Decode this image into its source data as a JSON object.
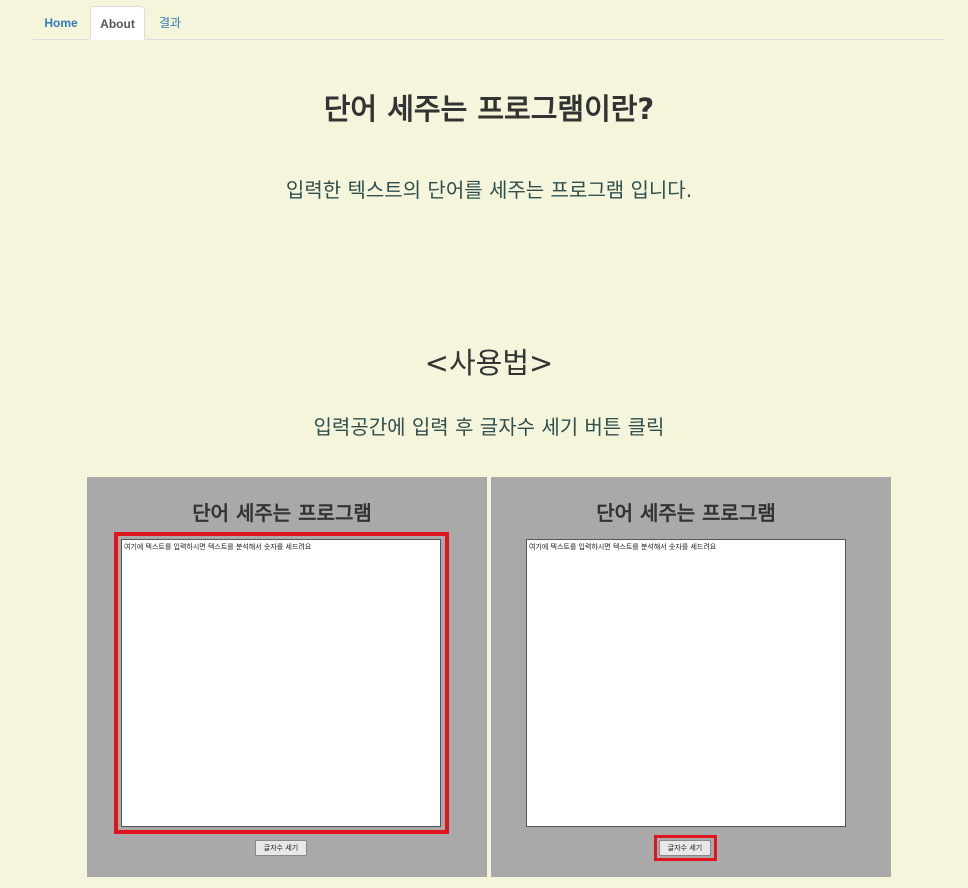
{
  "tabs": [
    {
      "label": "Home"
    },
    {
      "label": "About"
    },
    {
      "label": "결과"
    }
  ],
  "header": {
    "title": "단어 세주는 프로그램이란?",
    "description": "입력한 텍스트의 단어를 세주는 프로그램 입니다."
  },
  "usage": {
    "title": "<사용법>",
    "description": "입력공간에 입력 후 글자수 세기 버튼 클릭"
  },
  "panels": [
    {
      "title": "단어 세주는 프로그램",
      "textarea_value": "여기에 텍스트를 입력하시면 텍스트를 분석해서 숫자를 세드려요",
      "button_label": "글자수 세기"
    },
    {
      "title": "단어 세주는 프로그램",
      "textarea_value": "여기에 텍스트를 입력하시면 텍스트를 분석해서 숫자를 세드려요",
      "button_label": "글자수 세기"
    }
  ],
  "colors": {
    "background": "#f5f5dc",
    "panel": "#a9a9a9",
    "highlight": "#e0141c",
    "link": "#337ab7"
  }
}
